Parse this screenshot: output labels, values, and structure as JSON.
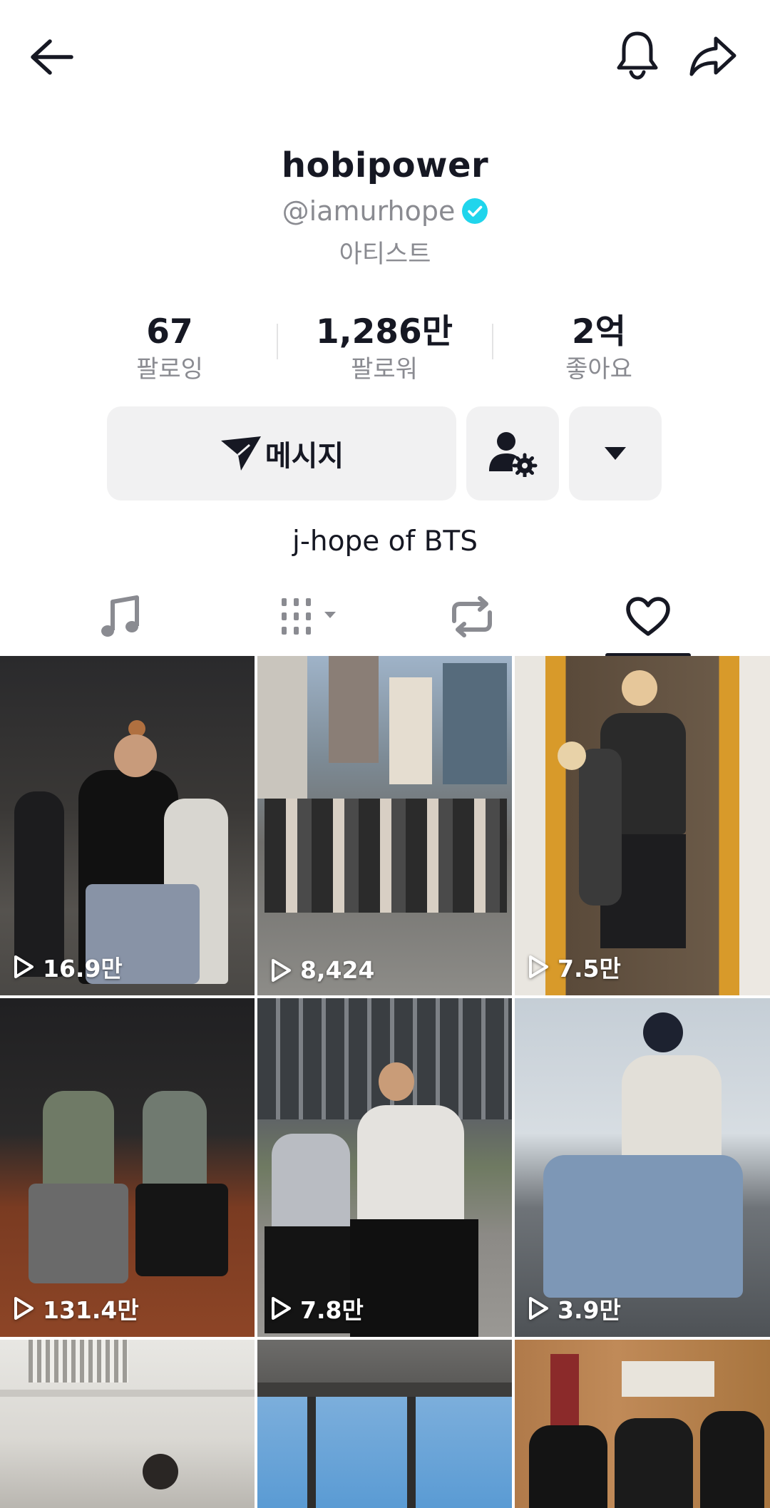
{
  "header": {
    "back_icon": "arrow-left-icon",
    "bell_icon": "bell-icon",
    "share_icon": "share-arrow-icon"
  },
  "profile": {
    "display_name": "hobipower",
    "handle": "@iamurhope",
    "verified_icon": "verified-check-icon",
    "verified_color": "#20d5ec",
    "category": "아티스트",
    "bio": "j-hope of BTS"
  },
  "stats": [
    {
      "value": "67",
      "label": "팔로잉"
    },
    {
      "value": "1,286만",
      "label": "팔로워"
    },
    {
      "value": "2억",
      "label": "좋아요"
    }
  ],
  "actions": {
    "message_label": "메시지",
    "message_icon": "send-icon",
    "friend_settings_icon": "user-gear-icon",
    "more_icon": "caret-down-icon"
  },
  "tabs": [
    {
      "icon": "music-note-icon",
      "selected": false
    },
    {
      "icon": "grid-filter-icon",
      "selected": false
    },
    {
      "icon": "repost-icon",
      "selected": false
    },
    {
      "icon": "heart-icon",
      "selected": true
    }
  ],
  "videos": [
    {
      "views": "16.9만"
    },
    {
      "views": "8,424"
    },
    {
      "views": "7.5만"
    },
    {
      "views": "131.4만"
    },
    {
      "views": "7.8만"
    },
    {
      "views": "3.9만"
    },
    {
      "views": ""
    },
    {
      "views": ""
    },
    {
      "views": ""
    }
  ]
}
